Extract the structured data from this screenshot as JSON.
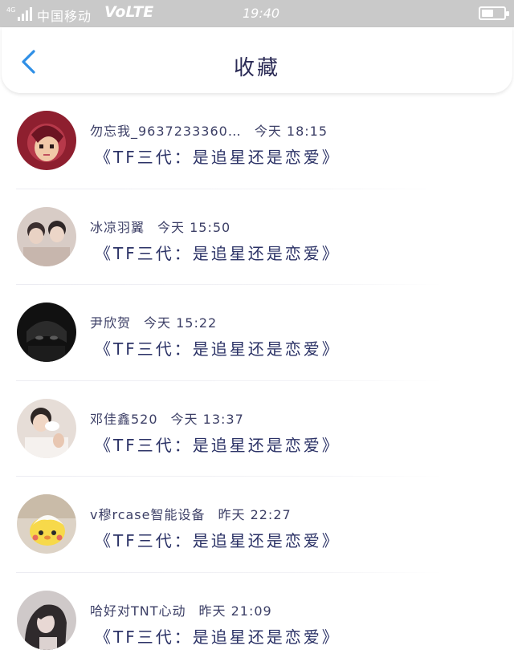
{
  "status_bar": {
    "network": "4G",
    "carrier": "中国移动",
    "volte": "VoLTE",
    "time": "19:40",
    "battery_level": 0.55
  },
  "header": {
    "back_icon": "chevron-left-icon",
    "title": "收藏"
  },
  "favorites": [
    {
      "sender": "勿忘我_9637233360…",
      "time": "今天 18:15",
      "subject": "《TF三代：是追星还是恋爱》"
    },
    {
      "sender": "冰凉羽翼",
      "time": "今天 15:50",
      "subject": "《TF三代：是追星还是恋爱》"
    },
    {
      "sender": "尹欣贺",
      "time": "今天 15:22",
      "subject": "《TF三代：是追星还是恋爱》"
    },
    {
      "sender": "邓佳鑫520",
      "time": "今天 13:37",
      "subject": "《TF三代：是追星还是恋爱》"
    },
    {
      "sender": "v穆rcase智能设备",
      "time": "昨天 22:27",
      "subject": "《TF三代：是追星还是恋爱》"
    },
    {
      "sender": "哈好对TNT心动",
      "time": "昨天 21:09",
      "subject": "《TF三代：是追星还是恋爱》"
    }
  ]
}
